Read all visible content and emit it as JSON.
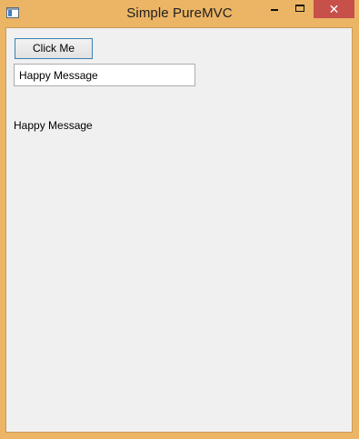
{
  "window": {
    "title": "Simple PureMVC",
    "accent_color": "#ebb565",
    "close_button_color": "#c7504a"
  },
  "titlebar": {
    "app_icon": "window-app-icon",
    "minimize_icon": "minimize-icon",
    "maximize_icon": "maximize-icon",
    "close_icon": "close-icon",
    "close_glyph": "✕"
  },
  "main": {
    "button_label": "Click Me",
    "input_value": "Happy Message",
    "message_text": "Happy Message"
  }
}
